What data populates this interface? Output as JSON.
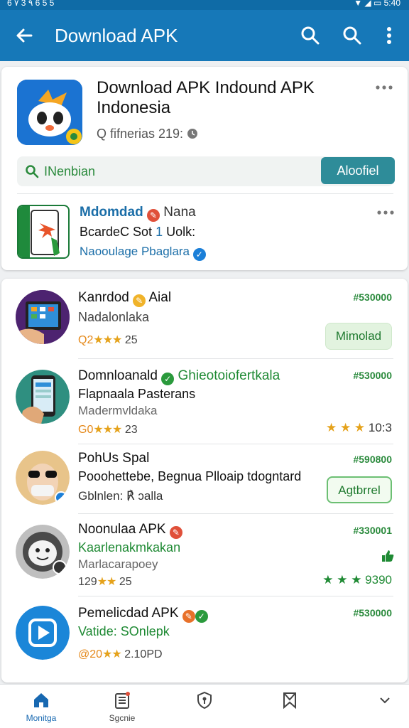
{
  "status_bar": {
    "left": "6 ٧ 3 ٩ 6 5 5",
    "right": "▼ ◢ ▭ 5:40"
  },
  "app_bar": {
    "title": "Download APK",
    "icons": [
      "back-arrow-icon",
      "search-icon",
      "search-icon",
      "more-vert-icon"
    ]
  },
  "header": {
    "title": "Download APK Indound APK Indonesia",
    "subtitle": "Q fifnerias 219:",
    "search": {
      "placeholder": "INenbian"
    },
    "action_button": "Aloofiel"
  },
  "featured": {
    "name": "Mdomdad",
    "name_suffix": "Nana",
    "line2": "BcardeC Sot",
    "line2_num": "1",
    "line2_suffix": "Uolk:",
    "developer": "Naooulage Pbaglara"
  },
  "apps": [
    {
      "title": "Kanrdod",
      "title_suffix": "Aial",
      "subtitle": "Nadalonlaka",
      "rating_prefix": "Q2",
      "stars": "★★★",
      "rating_count": "25",
      "price": "#530000",
      "button": "Mimolad"
    },
    {
      "title": "Domnloanald",
      "title_suffix": "Ghieotoiofertkala",
      "subtitle": "Flapnaala Pasterans",
      "developer": "Madermvldaka",
      "rating_prefix": "G0",
      "stars": "★★★",
      "rating_count": "23",
      "price": "#530000",
      "right_rating": "10:3"
    },
    {
      "title": "PohUs Spal",
      "subtitle": "Pooohettebe, Begnua Plloaip",
      "subtitle_suffix": "tdogntard",
      "developer": "Gblnlen: ℟ ɔalla",
      "price": "#590800",
      "button": "Agtbrrel"
    },
    {
      "title": "Noonulaa APK",
      "subtitle": "Kaarlenakmkakan",
      "developer": "Marlacarapoey",
      "rating_prefix": "129",
      "stars": "★★",
      "rating_count": "25",
      "price": "#330001",
      "right_rating": "9390"
    },
    {
      "title": "Pemelicdad APK",
      "subtitle": "Vatide: SOnlepk",
      "rating_prefix": "@20",
      "stars": "★★",
      "rating_count": "2.10PD",
      "price": "#530000"
    }
  ],
  "bottom_nav": [
    {
      "label": "Monitga",
      "icon": "home-icon",
      "active": true
    },
    {
      "label": "Sgcnie",
      "icon": "news-icon",
      "active": false
    },
    {
      "label": "",
      "icon": "shield-icon",
      "active": false
    },
    {
      "label": "",
      "icon": "bookmark-icon",
      "active": false
    },
    {
      "label": "",
      "icon": "chevron-down-icon",
      "active": false
    }
  ],
  "colors": {
    "app_bar": "#1678b8",
    "accent_green": "#1f8a34",
    "teal_button": "#2e8c99",
    "link_blue": "#1b6ea8",
    "star": "#e5a21b"
  }
}
